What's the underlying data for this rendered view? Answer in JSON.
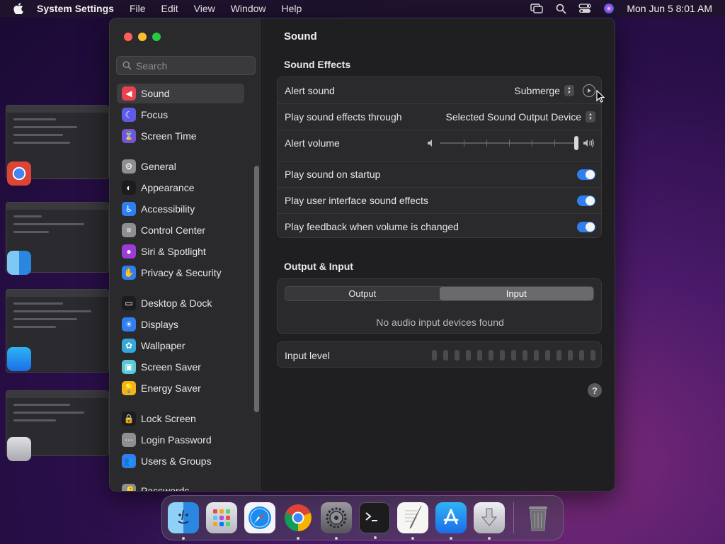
{
  "menubar": {
    "app_name": "System Settings",
    "menus": [
      "File",
      "Edit",
      "View",
      "Window",
      "Help"
    ],
    "clock": "Mon Jun 5  8:01 AM",
    "status_icons": [
      "screen-mirroring-icon",
      "spotlight-search-icon",
      "control-center-icon",
      "siri-icon"
    ]
  },
  "sidebar": {
    "search_placeholder": "Search",
    "items": [
      {
        "label": "Sound",
        "icon": "speaker-icon",
        "color": "#e8414f",
        "selected": true
      },
      {
        "label": "Focus",
        "icon": "moon-icon",
        "color": "#5e5ce6"
      },
      {
        "label": "Screen Time",
        "icon": "hourglass-icon",
        "color": "#6e55d9"
      },
      {
        "label": "General",
        "icon": "gear-icon",
        "color": "#8e8e93"
      },
      {
        "label": "Appearance",
        "icon": "appearance-icon",
        "color": "#1c1c1e"
      },
      {
        "label": "Accessibility",
        "icon": "accessibility-icon",
        "color": "#2f7ff0"
      },
      {
        "label": "Control Center",
        "icon": "control-center-icon",
        "color": "#8e8e93"
      },
      {
        "label": "Siri & Spotlight",
        "icon": "siri-icon",
        "color": "#9b3cd9"
      },
      {
        "label": "Privacy & Security",
        "icon": "hand-icon",
        "color": "#2f7ff0"
      },
      {
        "label": "Desktop & Dock",
        "icon": "dock-icon",
        "color": "#1c1c1e"
      },
      {
        "label": "Displays",
        "icon": "sun-icon",
        "color": "#2f7ff0"
      },
      {
        "label": "Wallpaper",
        "icon": "flower-icon",
        "color": "#35a7d8"
      },
      {
        "label": "Screen Saver",
        "icon": "screen-saver-icon",
        "color": "#5ac8d6"
      },
      {
        "label": "Energy Saver",
        "icon": "lightbulb-icon",
        "color": "#f5b31a"
      },
      {
        "label": "Lock Screen",
        "icon": "lock-icon",
        "color": "#1c1c1e"
      },
      {
        "label": "Login Password",
        "icon": "login-icon",
        "color": "#8e8e93"
      },
      {
        "label": "Users & Groups",
        "icon": "users-icon",
        "color": "#2f7ff0"
      },
      {
        "label": "Passwords",
        "icon": "key-icon",
        "color": "#8e8e93"
      }
    ]
  },
  "main": {
    "title": "Sound",
    "sound_effects": {
      "section_title": "Sound Effects",
      "alert_sound_label": "Alert sound",
      "alert_sound_value": "Submerge",
      "play_through_label": "Play sound effects through",
      "play_through_value": "Selected Sound Output Device",
      "alert_volume_label": "Alert volume",
      "alert_volume_level": 1.0,
      "startup_label": "Play sound on startup",
      "startup_on": true,
      "ui_effects_label": "Play user interface sound effects",
      "ui_effects_on": true,
      "feedback_label": "Play feedback when volume is changed",
      "feedback_on": true
    },
    "output_input": {
      "section_title": "Output & Input",
      "tabs": [
        "Output",
        "Input"
      ],
      "selected_tab": "Input",
      "empty_message": "No audio input devices found",
      "input_level_label": "Input level",
      "input_level": 0
    },
    "help_label": "?"
  },
  "dock": {
    "apps": [
      "Finder",
      "Launchpad",
      "Safari",
      "Google Chrome",
      "System Settings",
      "Terminal",
      "TextEdit",
      "App Store",
      "Downloads",
      "Trash"
    ]
  }
}
